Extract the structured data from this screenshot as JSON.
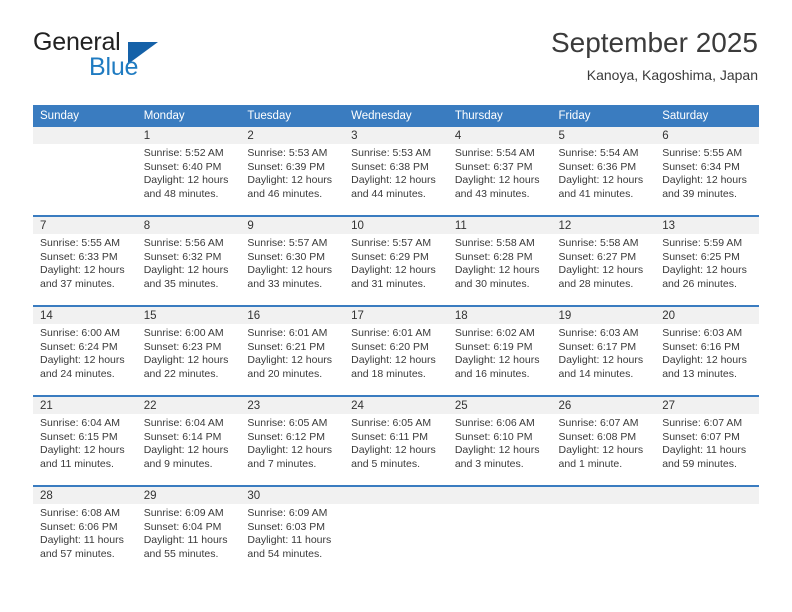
{
  "brand": {
    "word1": "General",
    "word2": "Blue",
    "triangle_color": "#1561a8",
    "blue_color": "#1f7bc1"
  },
  "header": {
    "title": "September 2025",
    "location": "Kanoya, Kagoshima, Japan"
  },
  "theme": {
    "header_blue": "#3a7cc0",
    "daynum_band": "#f1f1f1",
    "text": "#3a3a3a"
  },
  "weekday_headers": [
    "Sunday",
    "Monday",
    "Tuesday",
    "Wednesday",
    "Thursday",
    "Friday",
    "Saturday"
  ],
  "labels": {
    "sunrise_prefix": "Sunrise:",
    "sunset_prefix": "Sunset:",
    "daylight_prefix": "Daylight:"
  },
  "weeks": [
    [
      {
        "day": "",
        "sunrise": "",
        "sunset": "",
        "daylight_1": "",
        "daylight_2": "",
        "empty": true
      },
      {
        "day": "1",
        "sunrise": "Sunrise: 5:52 AM",
        "sunset": "Sunset: 6:40 PM",
        "daylight_1": "Daylight: 12 hours",
        "daylight_2": "and 48 minutes."
      },
      {
        "day": "2",
        "sunrise": "Sunrise: 5:53 AM",
        "sunset": "Sunset: 6:39 PM",
        "daylight_1": "Daylight: 12 hours",
        "daylight_2": "and 46 minutes."
      },
      {
        "day": "3",
        "sunrise": "Sunrise: 5:53 AM",
        "sunset": "Sunset: 6:38 PM",
        "daylight_1": "Daylight: 12 hours",
        "daylight_2": "and 44 minutes."
      },
      {
        "day": "4",
        "sunrise": "Sunrise: 5:54 AM",
        "sunset": "Sunset: 6:37 PM",
        "daylight_1": "Daylight: 12 hours",
        "daylight_2": "and 43 minutes."
      },
      {
        "day": "5",
        "sunrise": "Sunrise: 5:54 AM",
        "sunset": "Sunset: 6:36 PM",
        "daylight_1": "Daylight: 12 hours",
        "daylight_2": "and 41 minutes."
      },
      {
        "day": "6",
        "sunrise": "Sunrise: 5:55 AM",
        "sunset": "Sunset: 6:34 PM",
        "daylight_1": "Daylight: 12 hours",
        "daylight_2": "and 39 minutes."
      }
    ],
    [
      {
        "day": "7",
        "sunrise": "Sunrise: 5:55 AM",
        "sunset": "Sunset: 6:33 PM",
        "daylight_1": "Daylight: 12 hours",
        "daylight_2": "and 37 minutes."
      },
      {
        "day": "8",
        "sunrise": "Sunrise: 5:56 AM",
        "sunset": "Sunset: 6:32 PM",
        "daylight_1": "Daylight: 12 hours",
        "daylight_2": "and 35 minutes."
      },
      {
        "day": "9",
        "sunrise": "Sunrise: 5:57 AM",
        "sunset": "Sunset: 6:30 PM",
        "daylight_1": "Daylight: 12 hours",
        "daylight_2": "and 33 minutes."
      },
      {
        "day": "10",
        "sunrise": "Sunrise: 5:57 AM",
        "sunset": "Sunset: 6:29 PM",
        "daylight_1": "Daylight: 12 hours",
        "daylight_2": "and 31 minutes."
      },
      {
        "day": "11",
        "sunrise": "Sunrise: 5:58 AM",
        "sunset": "Sunset: 6:28 PM",
        "daylight_1": "Daylight: 12 hours",
        "daylight_2": "and 30 minutes."
      },
      {
        "day": "12",
        "sunrise": "Sunrise: 5:58 AM",
        "sunset": "Sunset: 6:27 PM",
        "daylight_1": "Daylight: 12 hours",
        "daylight_2": "and 28 minutes."
      },
      {
        "day": "13",
        "sunrise": "Sunrise: 5:59 AM",
        "sunset": "Sunset: 6:25 PM",
        "daylight_1": "Daylight: 12 hours",
        "daylight_2": "and 26 minutes."
      }
    ],
    [
      {
        "day": "14",
        "sunrise": "Sunrise: 6:00 AM",
        "sunset": "Sunset: 6:24 PM",
        "daylight_1": "Daylight: 12 hours",
        "daylight_2": "and 24 minutes."
      },
      {
        "day": "15",
        "sunrise": "Sunrise: 6:00 AM",
        "sunset": "Sunset: 6:23 PM",
        "daylight_1": "Daylight: 12 hours",
        "daylight_2": "and 22 minutes."
      },
      {
        "day": "16",
        "sunrise": "Sunrise: 6:01 AM",
        "sunset": "Sunset: 6:21 PM",
        "daylight_1": "Daylight: 12 hours",
        "daylight_2": "and 20 minutes."
      },
      {
        "day": "17",
        "sunrise": "Sunrise: 6:01 AM",
        "sunset": "Sunset: 6:20 PM",
        "daylight_1": "Daylight: 12 hours",
        "daylight_2": "and 18 minutes."
      },
      {
        "day": "18",
        "sunrise": "Sunrise: 6:02 AM",
        "sunset": "Sunset: 6:19 PM",
        "daylight_1": "Daylight: 12 hours",
        "daylight_2": "and 16 minutes."
      },
      {
        "day": "19",
        "sunrise": "Sunrise: 6:03 AM",
        "sunset": "Sunset: 6:17 PM",
        "daylight_1": "Daylight: 12 hours",
        "daylight_2": "and 14 minutes."
      },
      {
        "day": "20",
        "sunrise": "Sunrise: 6:03 AM",
        "sunset": "Sunset: 6:16 PM",
        "daylight_1": "Daylight: 12 hours",
        "daylight_2": "and 13 minutes."
      }
    ],
    [
      {
        "day": "21",
        "sunrise": "Sunrise: 6:04 AM",
        "sunset": "Sunset: 6:15 PM",
        "daylight_1": "Daylight: 12 hours",
        "daylight_2": "and 11 minutes."
      },
      {
        "day": "22",
        "sunrise": "Sunrise: 6:04 AM",
        "sunset": "Sunset: 6:14 PM",
        "daylight_1": "Daylight: 12 hours",
        "daylight_2": "and 9 minutes."
      },
      {
        "day": "23",
        "sunrise": "Sunrise: 6:05 AM",
        "sunset": "Sunset: 6:12 PM",
        "daylight_1": "Daylight: 12 hours",
        "daylight_2": "and 7 minutes."
      },
      {
        "day": "24",
        "sunrise": "Sunrise: 6:05 AM",
        "sunset": "Sunset: 6:11 PM",
        "daylight_1": "Daylight: 12 hours",
        "daylight_2": "and 5 minutes."
      },
      {
        "day": "25",
        "sunrise": "Sunrise: 6:06 AM",
        "sunset": "Sunset: 6:10 PM",
        "daylight_1": "Daylight: 12 hours",
        "daylight_2": "and 3 minutes."
      },
      {
        "day": "26",
        "sunrise": "Sunrise: 6:07 AM",
        "sunset": "Sunset: 6:08 PM",
        "daylight_1": "Daylight: 12 hours",
        "daylight_2": "and 1 minute."
      },
      {
        "day": "27",
        "sunrise": "Sunrise: 6:07 AM",
        "sunset": "Sunset: 6:07 PM",
        "daylight_1": "Daylight: 11 hours",
        "daylight_2": "and 59 minutes."
      }
    ],
    [
      {
        "day": "28",
        "sunrise": "Sunrise: 6:08 AM",
        "sunset": "Sunset: 6:06 PM",
        "daylight_1": "Daylight: 11 hours",
        "daylight_2": "and 57 minutes."
      },
      {
        "day": "29",
        "sunrise": "Sunrise: 6:09 AM",
        "sunset": "Sunset: 6:04 PM",
        "daylight_1": "Daylight: 11 hours",
        "daylight_2": "and 55 minutes."
      },
      {
        "day": "30",
        "sunrise": "Sunrise: 6:09 AM",
        "sunset": "Sunset: 6:03 PM",
        "daylight_1": "Daylight: 11 hours",
        "daylight_2": "and 54 minutes."
      },
      {
        "day": "",
        "sunrise": "",
        "sunset": "",
        "daylight_1": "",
        "daylight_2": "",
        "empty": true
      },
      {
        "day": "",
        "sunrise": "",
        "sunset": "",
        "daylight_1": "",
        "daylight_2": "",
        "empty": true
      },
      {
        "day": "",
        "sunrise": "",
        "sunset": "",
        "daylight_1": "",
        "daylight_2": "",
        "empty": true
      },
      {
        "day": "",
        "sunrise": "",
        "sunset": "",
        "daylight_1": "",
        "daylight_2": "",
        "empty": true
      }
    ]
  ]
}
